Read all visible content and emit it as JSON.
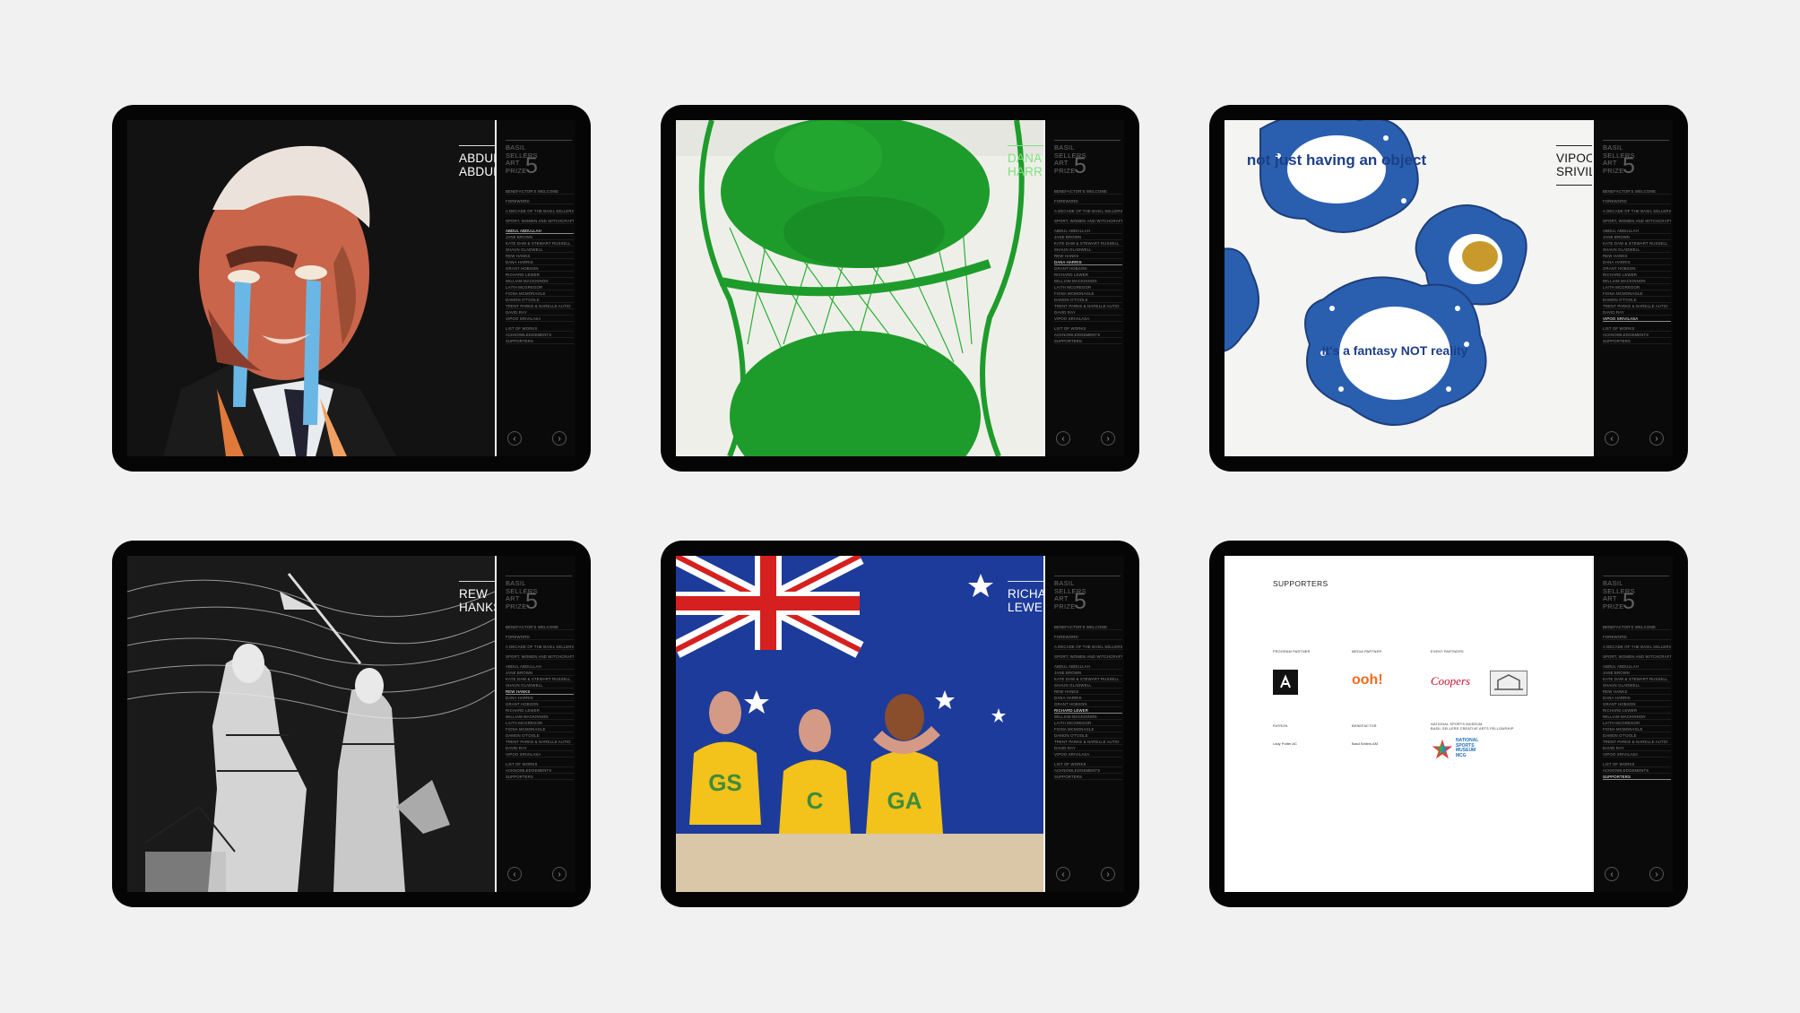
{
  "brand": {
    "words": "BASIL\nSELLERS\nART\nPRIZE",
    "number": "5"
  },
  "menu": [
    "Benefactor's welcome",
    "Foreword",
    "A decade of the Basil Sellers Art Prize",
    "Sport, women and witchcraft",
    "Abdul Abdullah",
    "Jane Brown",
    "Kate Daw & Stewart Russell",
    "Shaun Gladwell",
    "Rew Hanks",
    "Dana Harris",
    "Grant Hobson",
    "Richard Lewer",
    "William Mackinnon",
    "Laith McGregor",
    "Fiona McMonagle",
    "Damon O'Toole",
    "Trent Parke & Narelle Autio",
    "David Ray",
    "Vipoo Srivilasa",
    "List of works",
    "Acknowledgements",
    "Supporters"
  ],
  "nav": {
    "prev": "‹",
    "next": "›"
  },
  "tablets": [
    {
      "title": "ABDUL\nABDULLAH",
      "active": "Abdul Abdullah",
      "art": "abdul"
    },
    {
      "title": "DANA\nHARRIS",
      "active": "Dana Harris",
      "art": "dana"
    },
    {
      "title": "VIPOO\nSRIVILASA",
      "active": "Vipoo Srivilasa",
      "art": "vipoo"
    },
    {
      "title": "REW\nHANKS",
      "active": "Rew Hanks",
      "art": "rew"
    },
    {
      "title": "RICHARD\nLEWER",
      "active": "Richard Lewer",
      "art": "richard"
    },
    {
      "title": "",
      "active": "Supporters",
      "art": "supporters"
    }
  ],
  "art_text": {
    "vipoo_plates": [
      "not just having an object",
      "It's a fantasy NOT reality"
    ],
    "richard_shirts": [
      "GS",
      "C",
      "GA"
    ]
  },
  "supporters": {
    "heading": "SUPPORTERS",
    "program_partner": "PROGRAM PARTNER",
    "media_partner": "MEDIA PARTNER",
    "event_partners": "EVENT PARTNERS",
    "patron": "PATRON",
    "benefactor": "BENEFACTOR",
    "museum_label": "NATIONAL SPORTS MUSEUM\nBASIL SELLERS CREATIVE ARTS FELLOWSHIP",
    "patron_name": "Lady Potter AC",
    "benefactor_name": "Basil Sellers AM",
    "media_logo": "ooh!",
    "event_logo": "Coopers",
    "museum_logo": "NATIONAL\nSPORTS\nMUSEUM\nMCG"
  },
  "colors": {
    "screen_bg": "#000000",
    "panel_bg": "#0a0a0a",
    "knit_green": "#1e9c2b",
    "flag_blue": "#1d3b9a",
    "vipoo_blue": "#2a5fb0",
    "uniform_yellow": "#f3c21b"
  }
}
